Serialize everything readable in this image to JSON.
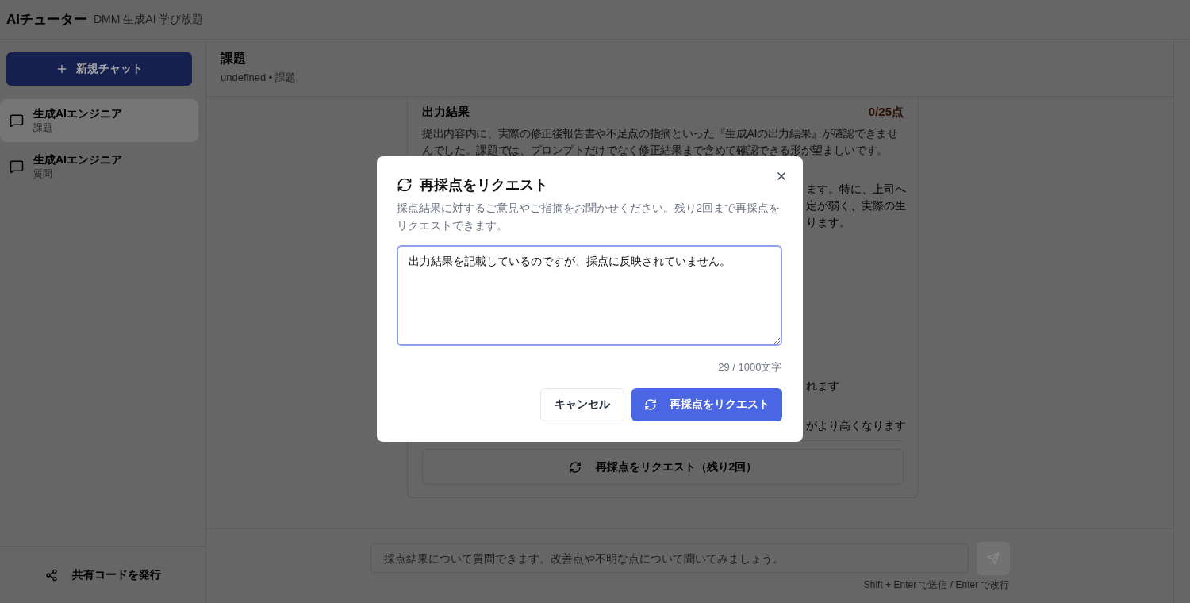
{
  "app": {
    "title": "AIチューター",
    "subtitle": "DMM 生成AI 学び放題"
  },
  "sidebar": {
    "new_chat_button": {
      "label": "新規チャット"
    },
    "items": [
      {
        "title": "生成AIエンジニア",
        "subtitle": "課題",
        "selected": true
      },
      {
        "title": "生成AIエンジニア",
        "subtitle": "質問",
        "selected": false
      }
    ],
    "share_button": {
      "label": "共有コードを発行"
    }
  },
  "main": {
    "title": "課題",
    "meta": "undefined • 課題"
  },
  "result_card": {
    "section_title": "出力結果",
    "score": "0/25点",
    "feedback": "提出内容内に、実際の修正後報告書や不足点の指摘といった『生成AIの出力結果』が確認できませんでした。課題では、プロンプトだけでなく修正結果まで含めて確認できる形が望ましいです。",
    "partial_blocks": [
      [
        "ます。特に、上司へ",
        "定が弱く、実際の生",
        "ります。"
      ],
      [
        "れます"
      ],
      [
        "がより高くなります"
      ]
    ],
    "request_button": {
      "label": "再採点をリクエスト（残り2回）"
    }
  },
  "chat_input": {
    "placeholder": "採点結果について質問できます。改善点や不明な点について聞いてみましょう。",
    "send_disabled": true,
    "hint": "Shift + Enter で送信 / Enter で改行"
  },
  "dialog": {
    "title": "再採点をリクエスト",
    "description": "採点結果に対するご意見やご指摘をお聞かせください。残り2回まで再採点をリクエストできます。",
    "feedback_value": "出力結果を記載しているのですが、採点に反映されていません。",
    "counter": "29 / 1000文字",
    "buttons": [
      {
        "label": "キャンセル",
        "kind": "secondary"
      },
      {
        "label": "再採点をリクエスト",
        "kind": "primary"
      }
    ]
  }
}
